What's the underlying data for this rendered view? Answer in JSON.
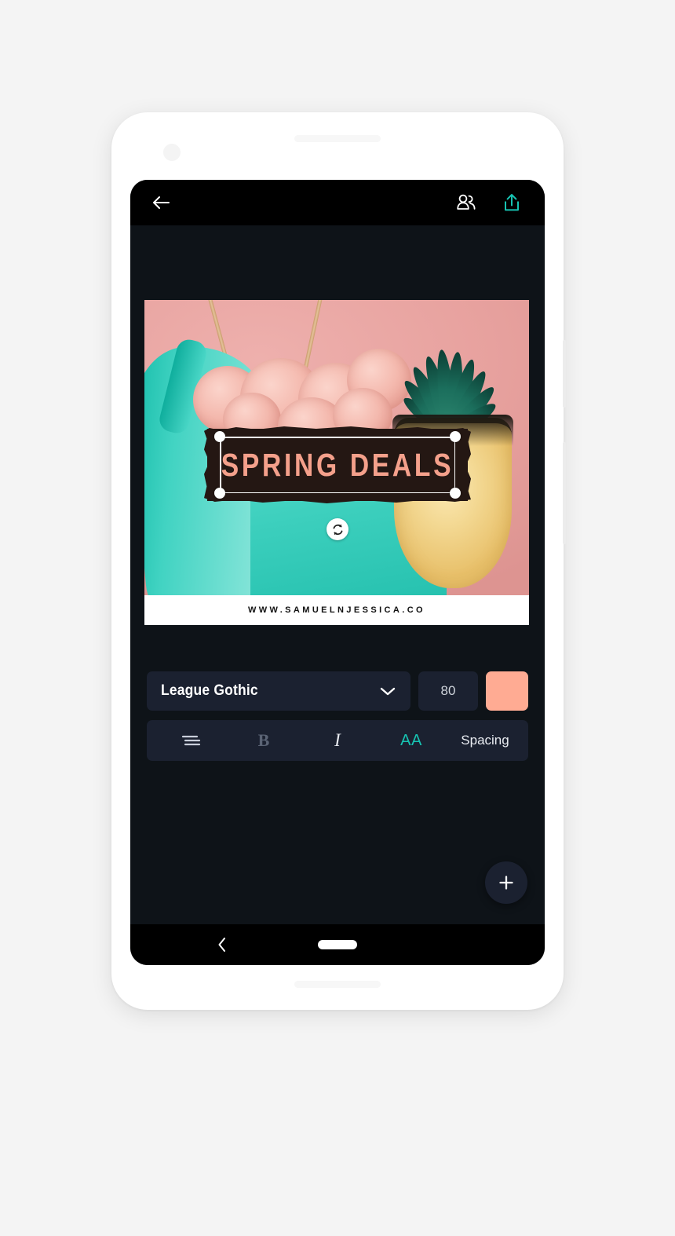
{
  "app": {
    "top_bar": {
      "back_icon": "arrow-left-icon",
      "collaborators_icon": "people-icon",
      "share_icon": "share-upload-icon",
      "share_color": "#17c3b2"
    }
  },
  "design": {
    "headline_text": "SPRING DEALS",
    "headline_color": "#f4a08b",
    "headline_banner_color": "#241713",
    "url_text": "WWW.SAMUELNJESSICA.CO",
    "rotate_handle_icon": "rotate-icon",
    "photo_description": "pink background with teal tank top, pink floral necklace and pineapple"
  },
  "text_controls": {
    "font_family": "League Gothic",
    "font_dropdown_icon": "chevron-down-icon",
    "font_size": "80",
    "font_color": "#ffab93",
    "toolbar": {
      "align_icon": "align-center-icon",
      "bold_label": "B",
      "bold_active": false,
      "italic_label": "I",
      "italic_active": false,
      "case_label": "AA",
      "case_active": true,
      "case_color": "#17c3b2",
      "spacing_label": "Spacing"
    }
  },
  "fab": {
    "icon": "plus-icon"
  },
  "android_nav": {
    "back_icon": "chevron-left-icon",
    "home_icon": "home-pill-icon"
  },
  "theme": {
    "page_background": "#f4f4f4",
    "phone_body": "#ffffff",
    "screen_background": "#0e1318",
    "panel_background": "#1b2130",
    "top_bar_background": "#000000",
    "accent": "#17c3b2"
  }
}
